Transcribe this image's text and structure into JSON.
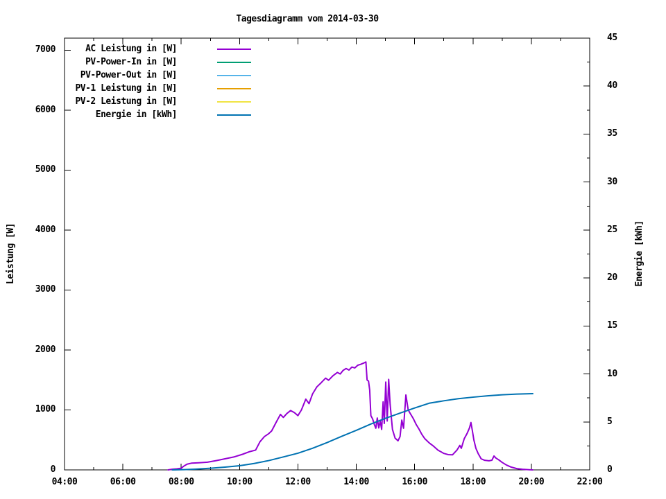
{
  "window": {
    "background": "#ffffff",
    "text_color": "#000000"
  },
  "chart_data": {
    "type": "line",
    "title": "Tagesdiagramm vom 2014-03-30",
    "grid": false,
    "legend_position": "top-left-inside",
    "x_axis": {
      "min_hour": 4,
      "max_hour": 22,
      "tick_values": [
        4,
        6,
        8,
        10,
        12,
        14,
        16,
        18,
        20,
        22
      ],
      "tick_labels": [
        "04:00",
        "06:00",
        "08:00",
        "10:00",
        "12:00",
        "14:00",
        "16:00",
        "18:00",
        "20:00",
        "22:00"
      ],
      "minor_tick_step_hours": 1
    },
    "y_left": {
      "label": "Leistung [W]",
      "min": 0,
      "plot_max": 7200,
      "tick_values": [
        0,
        1000,
        2000,
        3000,
        4000,
        5000,
        6000,
        7000
      ],
      "tick_labels": [
        "0",
        "1000",
        "2000",
        "3000",
        "4000",
        "5000",
        "6000",
        "7000"
      ]
    },
    "y_right": {
      "label": "Energie [kWh]",
      "min": 0,
      "plot_max": 45,
      "tick_values": [
        0,
        5,
        10,
        15,
        20,
        25,
        30,
        35,
        40,
        45
      ],
      "tick_labels": [
        "0",
        "5",
        "10",
        "15",
        "20",
        "25",
        "30",
        "35",
        "40",
        "45"
      ],
      "minor_tick_step": 2.5
    },
    "series": [
      {
        "name": "AC Leistung in [W]",
        "color": "#9400d3",
        "axis": "left",
        "points": [
          [
            7.55,
            0
          ],
          [
            7.7,
            12
          ],
          [
            7.85,
            18
          ],
          [
            8.0,
            28
          ],
          [
            8.08,
            60
          ],
          [
            8.2,
            95
          ],
          [
            8.35,
            112
          ],
          [
            8.6,
            118
          ],
          [
            8.9,
            128
          ],
          [
            9.2,
            155
          ],
          [
            9.5,
            185
          ],
          [
            9.8,
            215
          ],
          [
            10.1,
            260
          ],
          [
            10.35,
            305
          ],
          [
            10.55,
            330
          ],
          [
            10.7,
            470
          ],
          [
            10.85,
            555
          ],
          [
            11.0,
            605
          ],
          [
            11.1,
            650
          ],
          [
            11.25,
            790
          ],
          [
            11.4,
            925
          ],
          [
            11.5,
            875
          ],
          [
            11.62,
            940
          ],
          [
            11.75,
            990
          ],
          [
            11.88,
            955
          ],
          [
            12.0,
            905
          ],
          [
            12.12,
            1000
          ],
          [
            12.27,
            1180
          ],
          [
            12.38,
            1105
          ],
          [
            12.5,
            1265
          ],
          [
            12.65,
            1385
          ],
          [
            12.8,
            1455
          ],
          [
            12.95,
            1530
          ],
          [
            13.05,
            1495
          ],
          [
            13.2,
            1570
          ],
          [
            13.35,
            1625
          ],
          [
            13.45,
            1600
          ],
          [
            13.55,
            1660
          ],
          [
            13.65,
            1690
          ],
          [
            13.75,
            1665
          ],
          [
            13.85,
            1715
          ],
          [
            13.95,
            1700
          ],
          [
            14.05,
            1745
          ],
          [
            14.15,
            1760
          ],
          [
            14.25,
            1780
          ],
          [
            14.33,
            1800
          ],
          [
            14.37,
            1500
          ],
          [
            14.42,
            1480
          ],
          [
            14.46,
            1330
          ],
          [
            14.5,
            905
          ],
          [
            14.56,
            850
          ],
          [
            14.62,
            755
          ],
          [
            14.67,
            695
          ],
          [
            14.72,
            865
          ],
          [
            14.77,
            700
          ],
          [
            14.82,
            815
          ],
          [
            14.87,
            675
          ],
          [
            14.92,
            1135
          ],
          [
            14.96,
            775
          ],
          [
            15.01,
            1465
          ],
          [
            15.06,
            815
          ],
          [
            15.11,
            1510
          ],
          [
            15.16,
            1095
          ],
          [
            15.24,
            675
          ],
          [
            15.33,
            530
          ],
          [
            15.43,
            485
          ],
          [
            15.5,
            555
          ],
          [
            15.56,
            830
          ],
          [
            15.62,
            695
          ],
          [
            15.7,
            1250
          ],
          [
            15.78,
            1000
          ],
          [
            15.85,
            940
          ],
          [
            15.95,
            860
          ],
          [
            16.05,
            760
          ],
          [
            16.15,
            680
          ],
          [
            16.25,
            590
          ],
          [
            16.35,
            520
          ],
          [
            16.5,
            450
          ],
          [
            16.65,
            395
          ],
          [
            16.8,
            330
          ],
          [
            17.0,
            275
          ],
          [
            17.15,
            255
          ],
          [
            17.3,
            252
          ],
          [
            17.45,
            330
          ],
          [
            17.55,
            408
          ],
          [
            17.6,
            360
          ],
          [
            17.7,
            520
          ],
          [
            17.8,
            610
          ],
          [
            17.88,
            700
          ],
          [
            17.93,
            790
          ],
          [
            17.98,
            650
          ],
          [
            18.03,
            500
          ],
          [
            18.1,
            360
          ],
          [
            18.18,
            270
          ],
          [
            18.28,
            185
          ],
          [
            18.4,
            160
          ],
          [
            18.55,
            152
          ],
          [
            18.65,
            162
          ],
          [
            18.72,
            232
          ],
          [
            18.79,
            196
          ],
          [
            18.88,
            168
          ],
          [
            19.0,
            125
          ],
          [
            19.15,
            80
          ],
          [
            19.3,
            48
          ],
          [
            19.5,
            22
          ],
          [
            19.7,
            10
          ],
          [
            19.88,
            4
          ],
          [
            20.05,
            0
          ]
        ]
      },
      {
        "name": "PV-Power-In in [W]",
        "color": "#009e73",
        "axis": "left",
        "points": []
      },
      {
        "name": "PV-Power-Out in [W]",
        "color": "#56b4e9",
        "axis": "left",
        "points": []
      },
      {
        "name": "PV-1 Leistung in [W]",
        "color": "#e69f00",
        "axis": "left",
        "points": []
      },
      {
        "name": "PV-2 Leistung in [W]",
        "color": "#f0e442",
        "axis": "left",
        "points": []
      },
      {
        "name": "Energie in [kWh]",
        "color": "#0072b2",
        "axis": "right",
        "points": [
          [
            7.7,
            0
          ],
          [
            8.1,
            0.03
          ],
          [
            8.5,
            0.08
          ],
          [
            9.0,
            0.17
          ],
          [
            9.5,
            0.29
          ],
          [
            10.0,
            0.43
          ],
          [
            10.5,
            0.67
          ],
          [
            11.0,
            0.97
          ],
          [
            11.5,
            1.35
          ],
          [
            12.0,
            1.74
          ],
          [
            12.5,
            2.25
          ],
          [
            13.0,
            2.85
          ],
          [
            13.5,
            3.5
          ],
          [
            14.0,
            4.12
          ],
          [
            14.5,
            4.78
          ],
          [
            15.0,
            5.38
          ],
          [
            15.5,
            5.92
          ],
          [
            16.0,
            6.45
          ],
          [
            16.5,
            6.95
          ],
          [
            17.0,
            7.2
          ],
          [
            17.5,
            7.42
          ],
          [
            18.0,
            7.58
          ],
          [
            18.5,
            7.72
          ],
          [
            19.0,
            7.83
          ],
          [
            19.5,
            7.9
          ],
          [
            20.05,
            7.95
          ]
        ]
      }
    ]
  }
}
